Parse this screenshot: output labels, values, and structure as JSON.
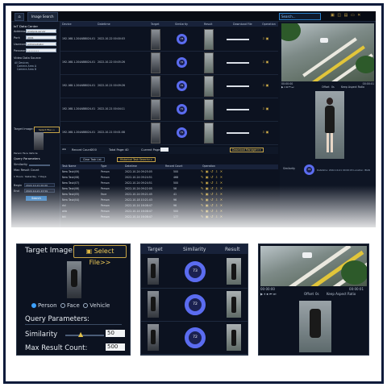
{
  "app": {
    "tab_label": "Image Search",
    "top_search_placeholder": "Search..."
  },
  "left": {
    "data_center_title": "IoT Data Center",
    "address_label": "Address:",
    "address_value": "analysis.server",
    "port_label": "Port:",
    "port_value": "4001",
    "username_label": "Username:",
    "username_value": "administrator",
    "password_label": "Password:",
    "password_value": "••••••••",
    "video_source_label": "Video Data Source:",
    "tree_items": [
      "All Devices",
      "Camera Area A",
      "Camera Area B"
    ],
    "target_image_label": "Target Image:",
    "select_file_label": "Select File>>",
    "types": [
      "Person",
      "Face",
      "Vehicle"
    ],
    "query_params_label": "Query Parameters",
    "similarity_label": "Similarity",
    "max_result_label": "Max Result Count",
    "time_opts": [
      "1 Hours",
      "Today",
      "Yesterday",
      "7 Days",
      "This week",
      "30 days"
    ],
    "begin_label": "Begin",
    "begin_value": "2022-10-21 00:00",
    "end_label": "End",
    "end_value": "2022-10-21 23:59",
    "search_button": "Search"
  },
  "results": {
    "headers": [
      "Device",
      "Datetime",
      "Target",
      "Similarity",
      "Result",
      "Download File",
      "Operation"
    ],
    "rows": [
      {
        "device": "192.168.1.204ABB024-01",
        "datetime": "2022-10-22 00:00:03",
        "sim": "73"
      },
      {
        "device": "192.168.1.204ABB024-01",
        "datetime": "2022-10-22 00:05:26",
        "sim": "72"
      },
      {
        "device": "192.168.1.204ABB024-01",
        "datetime": "2022-10-21 00:09:26",
        "sim": "72"
      },
      {
        "device": "192.168.1.204ABB024-01",
        "datetime": "2022-10-21 00:04:11",
        "sim": "71"
      },
      {
        "device": "192.168.1.204ABB024-01",
        "datetime": "2022-10-21 00:01:08",
        "sim": "71"
      }
    ]
  },
  "pager": {
    "record_label": "Record Count:",
    "record_value": "200",
    "total_page_label": "Total Page:",
    "total_page_value": "40",
    "current_page_label": "Current Page:",
    "download_manager": "Download Manager>>"
  },
  "tasks": {
    "clear_button": "Clear Task List",
    "history_button": "Historical Task Search>>",
    "headers": [
      "Task Name",
      "Type",
      "Datetime",
      "Record Count",
      "Operation"
    ],
    "rows": [
      {
        "name": "New Task(09)",
        "type": "Person",
        "datetime": "2022-10-24 09:25:05",
        "count": "500"
      },
      {
        "name": "New Task(08)",
        "type": "Person",
        "datetime": "2022-10-24 09:24:51",
        "count": "468"
      },
      {
        "name": "New Task(07)",
        "type": "Person",
        "datetime": "2022-10-24 09:24:51",
        "count": "500"
      },
      {
        "name": "New Task(06)",
        "type": "Person",
        "datetime": "2022-10-24 09:22:05",
        "count": "56"
      },
      {
        "name": "New Task(05)",
        "type": "Face",
        "datetime": "2022-10-24 09:21:45",
        "count": "41"
      },
      {
        "name": "New Task(04)",
        "type": "Person",
        "datetime": "2022-10-18 10:21:43",
        "count": "96"
      },
      {
        "name": "rtd",
        "type": "Person",
        "datetime": "2022-10-14 16:08:47",
        "count": "96"
      },
      {
        "name": "ahb",
        "type": "Person",
        "datetime": "2022-10-14 16:08:47",
        "count": "500"
      },
      {
        "name": "bkl",
        "type": "Person",
        "datetime": "2022-10-14 16:08:47",
        "count": "177"
      }
    ]
  },
  "right": {
    "time_start": "00:00:00",
    "time_end": "00:00:01",
    "offset_label": "Offset",
    "offset_value": "0s",
    "keep_aspect": "Keep Aspect Ratio",
    "similarity_label": "Similarity",
    "similarity_value": "73",
    "detail": "Datetime: 2022-10-21 00:00:03  Location: IBAN"
  },
  "zoom_left": {
    "target_label": "Target Image:",
    "select_file": "Select File>>",
    "types": [
      "Person",
      "Face",
      "Vehicle"
    ],
    "query_label": "Query Parameters:",
    "similarity_label": "Similarity",
    "similarity_value": "50",
    "max_label": "Max Result Count:",
    "max_value": "500"
  },
  "zoom_mid": {
    "headers": [
      "Target",
      "Similarity",
      "Result"
    ],
    "rows": [
      {
        "sim": "73"
      },
      {
        "sim": "72"
      },
      {
        "sim": "72"
      }
    ]
  },
  "zoom_right": {
    "time_start": "00:00:00",
    "time_end": "00:00:01",
    "offset_label": "Offset",
    "offset_value": "0s",
    "keep_aspect": "Keep Aspect Ratio"
  },
  "colors": {
    "accent": "#5b6cf0",
    "gold": "#c7a447",
    "frame": "#0b1a3a"
  }
}
